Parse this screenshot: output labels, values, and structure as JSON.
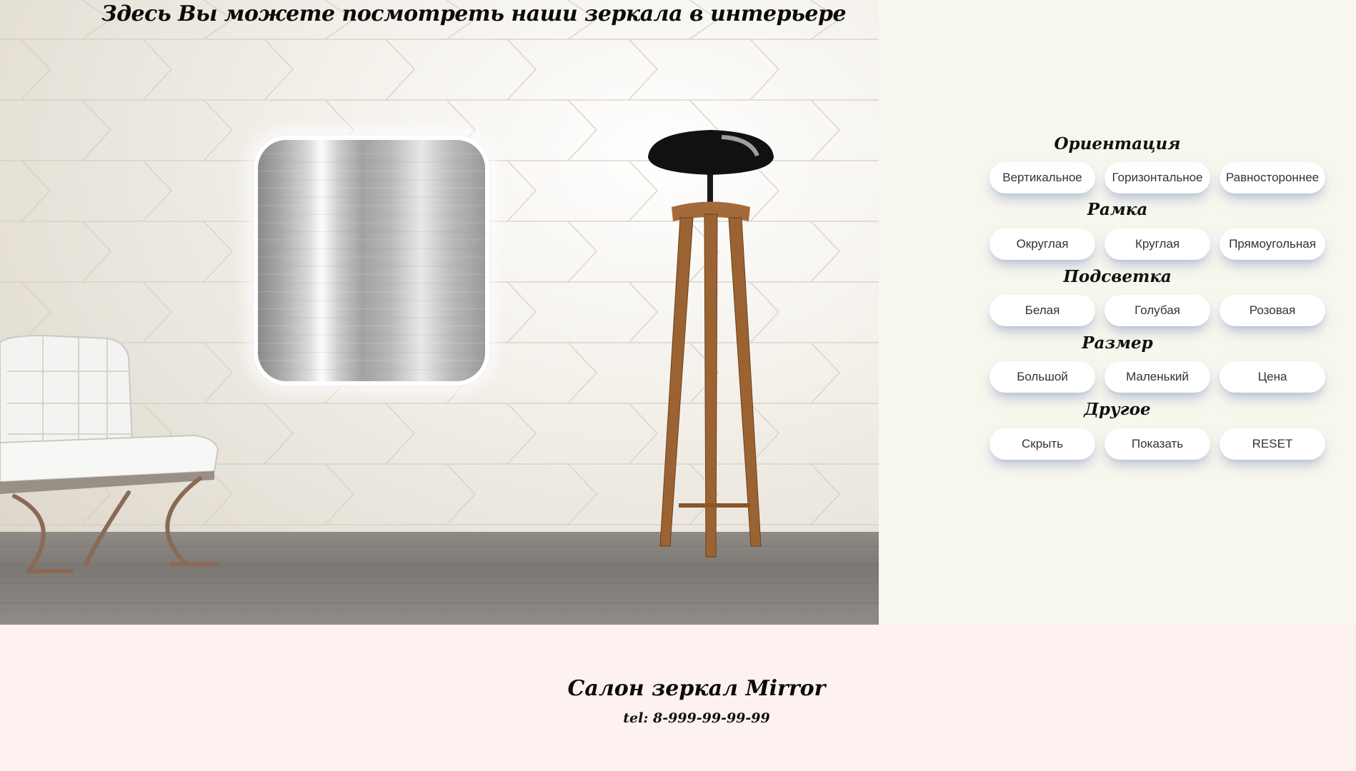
{
  "header": {
    "title": "Здесь Вы можете посмотреть наши зеркала в интерьере"
  },
  "controls": {
    "orientation": {
      "title": "Ориентация",
      "buttons": [
        "Вертикальное",
        "Горизонтальное",
        "Равностороннее"
      ]
    },
    "frame": {
      "title": "Рамка",
      "buttons": [
        "Округлая",
        "Круглая",
        "Прямоугольная"
      ]
    },
    "lighting": {
      "title": "Подсветка",
      "buttons": [
        "Белая",
        "Голубая",
        "Розовая"
      ]
    },
    "size": {
      "title": "Размер",
      "buttons": [
        "Большой",
        "Маленький",
        "Цена"
      ]
    },
    "other": {
      "title": "Другое",
      "buttons": [
        "Скрыть",
        "Показать",
        "RESET"
      ]
    }
  },
  "footer": {
    "title": "Салон зеркал Mirror",
    "phone": "tel: 8-999-99-99-99"
  },
  "colors": {
    "panel_background": "#f8f7ee",
    "footer_background": "#fdf2ef",
    "button_background": "#ffffff",
    "button_shadow": "#788cbe"
  }
}
